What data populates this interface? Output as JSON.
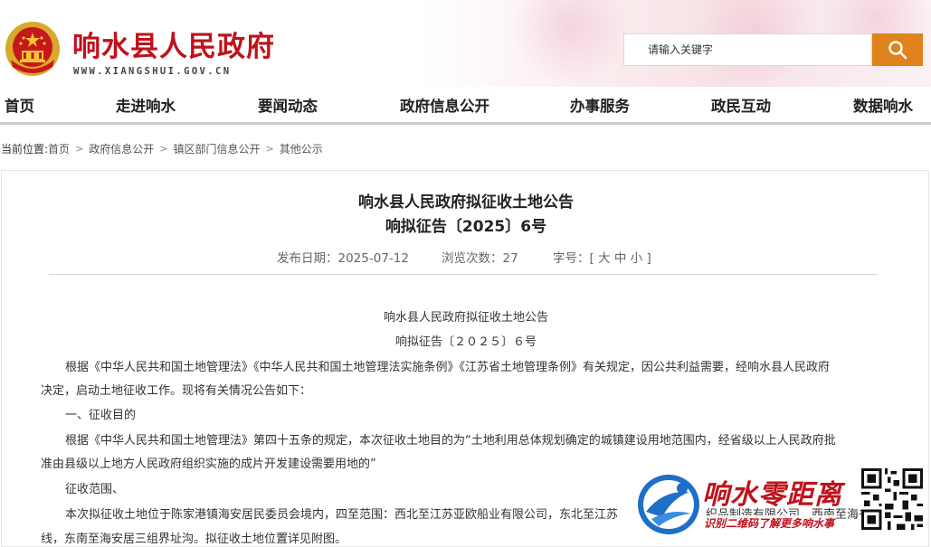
{
  "header": {
    "site_name": "响水县人民政府",
    "site_domain": "WWW.XIANGSHUI.GOV.CN",
    "search_placeholder": "请输入关键字"
  },
  "nav": [
    "首页",
    "走进响水",
    "要闻动态",
    "政府信息公开",
    "办事服务",
    "政民互动",
    "数据响水"
  ],
  "breadcrumb": {
    "label": "当前位置:",
    "items": [
      "首页",
      "政府信息公开",
      "镇区部门信息公开",
      "其他公示"
    ]
  },
  "article": {
    "title_line1": "响水县人民政府拟征收土地公告",
    "title_line2": "响拟征告〔2025〕6号",
    "publish_date": "发布日期：2025-07-12",
    "views": "浏览次数：27",
    "font_size_label": "字号：",
    "font_size_options": [
      "[",
      "大",
      "中",
      "小",
      "]"
    ],
    "body": {
      "heading1": "响水县人民政府拟征收土地公告",
      "heading2": "响拟征告〔２０２５〕６号",
      "p1_line1": "根据《中华人民共和国土地管理法》《中华人民共和国土地管理法实施条例》《江苏省土地管理条例》有关规定，因公共利益需要，经响水县人民政府",
      "p1_line2": "决定，启动土地征收工作。现将有关情况公告如下：",
      "s1": "一、征收目的",
      "p2_line1": "根据《中华人民共和国土地管理法》第四十五条的规定，本次征收土地目的为“土地利用总体规划确定的城镇建设用地范围内，经省级以上人民政府批",
      "p2_line2": "准由县级以上地方人民政府组织实施的成片开发建设需要用地的”",
      "s2": "征收范围、",
      "p3_line1": "本次拟征收土地位于陈家港镇海安居民委员会境内，四至范围：西北至江苏亚欧船业有限公司，东北至江苏",
      "p3_line1_tail": "织品制造有限公司，西南至海书",
      "p3_line2": "线，东南至海安居三组界址沟。拟征收土地位置详见附图。"
    }
  },
  "promo": {
    "title": "响水零距离",
    "subtitle": "识别二维码了解更多响水事"
  },
  "colors": {
    "brand_red": "#c0121b",
    "search_orange": "#e0831c",
    "nav_border": "#c9cdd3"
  }
}
